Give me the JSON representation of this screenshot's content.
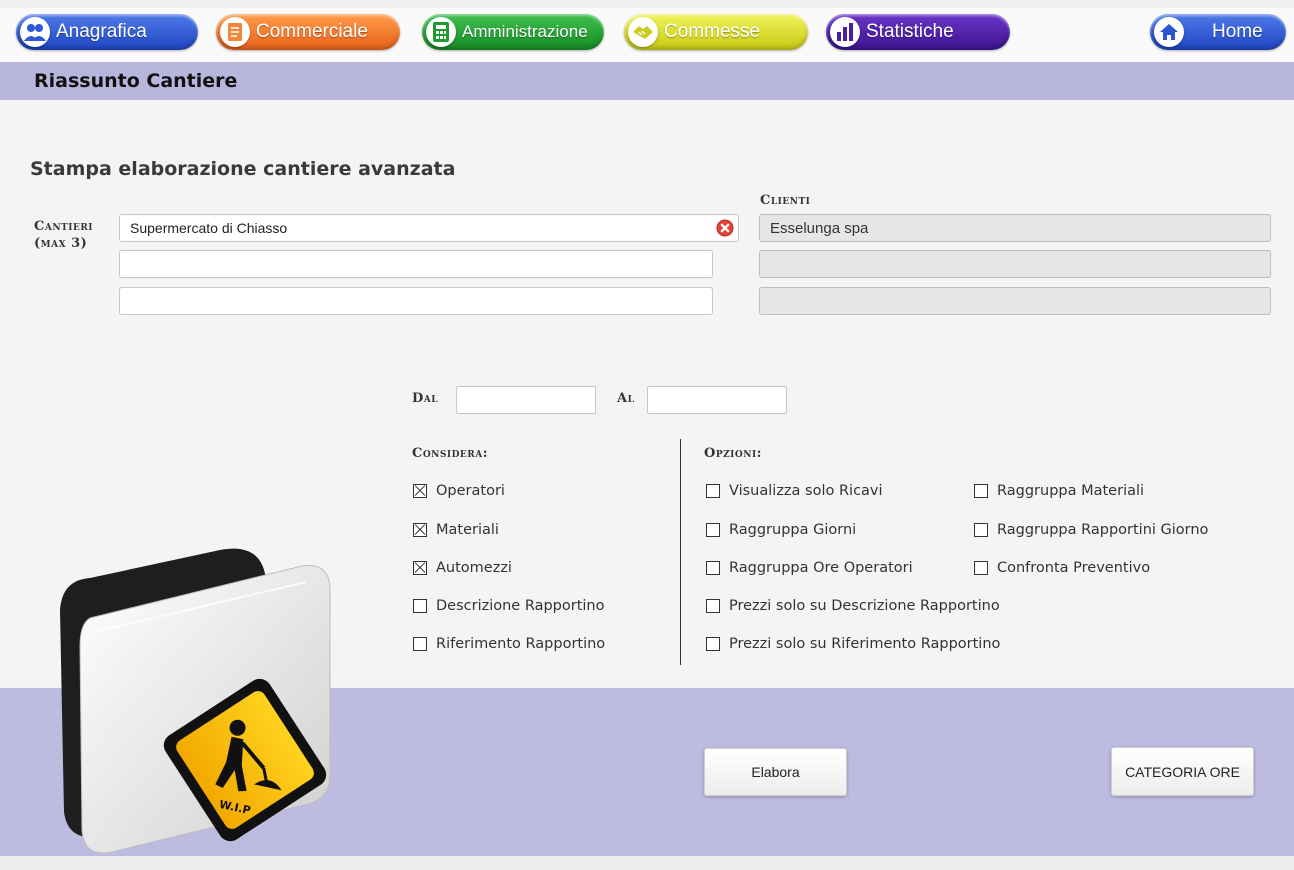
{
  "nav": {
    "anagrafica": "Anagrafica",
    "commerciale": "Commerciale",
    "amministrazione": "Amministrazione",
    "commesse": "Commesse",
    "statistiche": "Statistiche",
    "home": "Home"
  },
  "section": {
    "title": "Riassunto Cantiere"
  },
  "form": {
    "title": "Stampa elaborazione cantiere avanzata",
    "cantieri_label_line1": "Cantieri",
    "cantieri_label_line2": "(max 3)",
    "clienti_label": "Clienti",
    "cantieri": [
      "Supermercato di Chiasso",
      "",
      ""
    ],
    "clienti": [
      "Esselunga spa",
      "",
      ""
    ],
    "dal_label": "Dal",
    "al_label": "Al",
    "dal_value": "",
    "al_value": ""
  },
  "considera": {
    "title": "Considera:",
    "items": [
      {
        "label": "Operatori",
        "checked": true
      },
      {
        "label": "Materiali",
        "checked": true
      },
      {
        "label": "Automezzi",
        "checked": true
      },
      {
        "label": "Descrizione Rapportino",
        "checked": false
      },
      {
        "label": "Riferimento Rapportino",
        "checked": false
      }
    ]
  },
  "opzioni": {
    "title": "Opzioni:",
    "items": [
      {
        "label": "Visualizza solo Ricavi",
        "checked": false
      },
      {
        "label": "Raggruppa Materiali",
        "checked": false
      },
      {
        "label": "Raggruppa Giorni",
        "checked": false
      },
      {
        "label": "Raggruppa Rapportini Giorno",
        "checked": false
      },
      {
        "label": "Raggruppa Ore Operatori",
        "checked": false
      },
      {
        "label": "Confronta Preventivo",
        "checked": false
      },
      {
        "label": "Prezzi solo su Descrizione Rapportino",
        "checked": false
      },
      {
        "label": "Prezzi solo su Riferimento Rapportino",
        "checked": false
      }
    ]
  },
  "actions": {
    "elabora": "Elabora",
    "categoria_ore": "CATEGORIA ORE"
  },
  "graphic": {
    "sign_text": "W.I.P"
  },
  "colors": {
    "header_band": "#b9b6dd",
    "footer_band": "#bdbbdf",
    "clear_icon": "#e0453a"
  }
}
